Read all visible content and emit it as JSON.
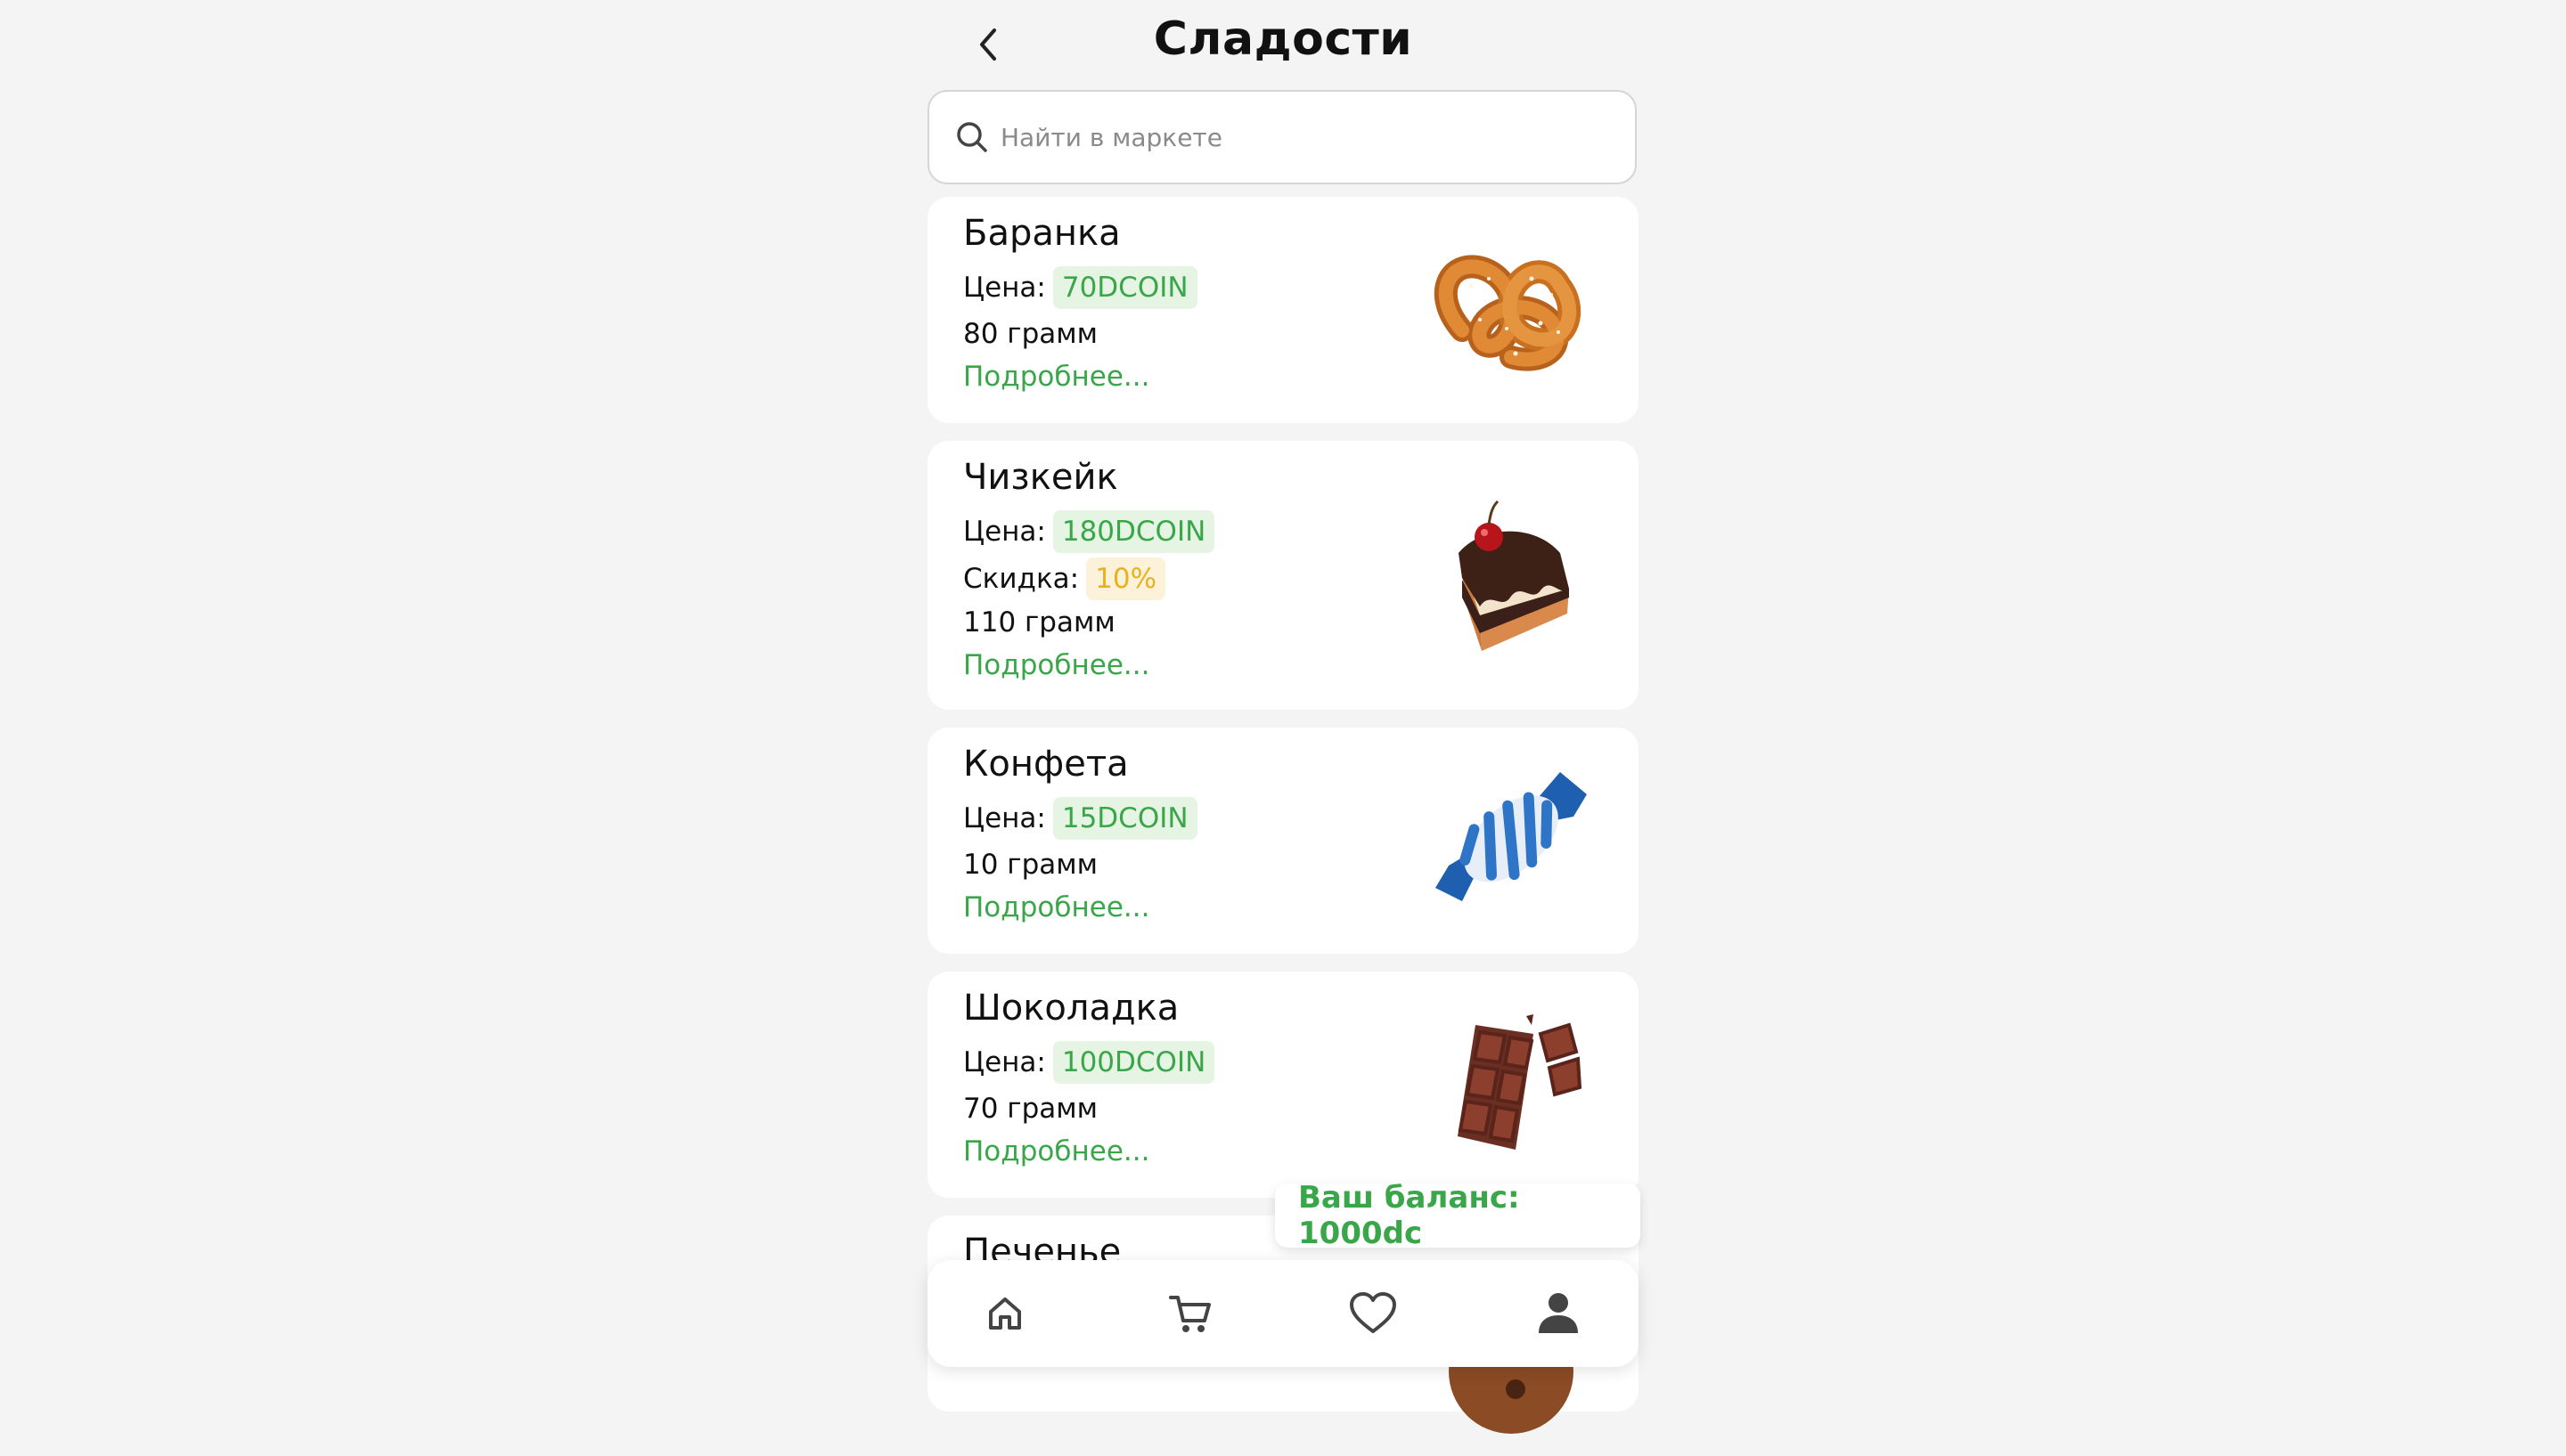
{
  "header": {
    "title": "Сладости",
    "back_icon": "chevron-left-icon"
  },
  "search": {
    "placeholder": "Найти в маркете",
    "value": "",
    "icon": "search-icon"
  },
  "labels": {
    "price": "Цена:",
    "discount": "Скидка:",
    "more": "Подробнее..."
  },
  "products": [
    {
      "name": "Баранка",
      "price": "70DCOIN",
      "weight": "80 грамм",
      "image": "pretzel"
    },
    {
      "name": "Чизкейк",
      "price": "180DCOIN",
      "discount": "10%",
      "weight": "110 грамм",
      "image": "cheesecake-slice"
    },
    {
      "name": "Конфета",
      "price": "15DCOIN",
      "weight": "10 грамм",
      "image": "wrapped-candy"
    },
    {
      "name": "Шоколадка",
      "price": "100DCOIN",
      "weight": "70 грамм",
      "image": "chocolate-bar"
    },
    {
      "name": "Печенье",
      "image": "cookie"
    }
  ],
  "balance": {
    "text": "Ваш баланс: 1000dc"
  },
  "tabbar": {
    "items": [
      "home-icon",
      "cart-icon",
      "heart-icon",
      "profile-icon"
    ]
  },
  "colors": {
    "accent_green": "#3aa64a",
    "green_pill_bg": "#e6f4e4",
    "discount_yellow": "#e9b21d",
    "yellow_pill_bg": "#fbf2d9",
    "background": "#f4f4f4"
  }
}
